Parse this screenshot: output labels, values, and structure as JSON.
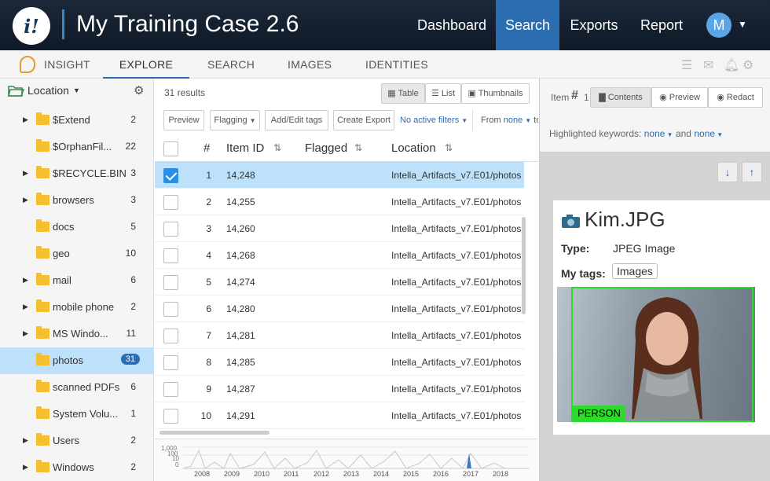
{
  "app": {
    "title": "My Training Case 2.6",
    "logo_text": "i!"
  },
  "topnav": {
    "dashboard": "Dashboard",
    "search": "Search",
    "exports": "Exports",
    "report": "Report",
    "avatar": "M"
  },
  "tabs": {
    "insight": "INSIGHT",
    "explore": "EXPLORE",
    "search": "SEARCH",
    "images": "IMAGES",
    "identities": "IDENTITIES"
  },
  "left": {
    "header": "Location",
    "items": [
      {
        "name": "$Extend",
        "count": "2",
        "arrow": true
      },
      {
        "name": "$OrphanFil...",
        "count": "22",
        "arrow": false
      },
      {
        "name": "$RECYCLE.BIN",
        "count": "3",
        "arrow": true
      },
      {
        "name": "browsers",
        "count": "3",
        "arrow": true
      },
      {
        "name": "docs",
        "count": "5",
        "arrow": false
      },
      {
        "name": "geo",
        "count": "10",
        "arrow": false
      },
      {
        "name": "mail",
        "count": "6",
        "arrow": true
      },
      {
        "name": "mobile phone",
        "count": "2",
        "arrow": true
      },
      {
        "name": "MS Windo...",
        "count": "11",
        "arrow": true
      },
      {
        "name": "photos",
        "count": "31",
        "arrow": false
      },
      {
        "name": "scanned PDFs",
        "count": "6",
        "arrow": false
      },
      {
        "name": "System Volu...",
        "count": "1",
        "arrow": false
      },
      {
        "name": "Users",
        "count": "2",
        "arrow": true
      },
      {
        "name": "Windows",
        "count": "2",
        "arrow": true
      }
    ]
  },
  "mid": {
    "results": "31 results",
    "view_table": "Table",
    "view_list": "List",
    "view_thumbnails": "Thumbnails",
    "btn_preview": "Preview",
    "btn_flagging": "Flagging",
    "btn_add_edit_tags": "Add/Edit tags",
    "btn_create_export": "Create Export",
    "filters": "No active filters",
    "from_label": "From",
    "from_value": "none",
    "to_label": "to",
    "col_num": "#",
    "col_item_id": "Item ID",
    "col_flagged": "Flagged",
    "col_location": "Location",
    "rows": [
      {
        "n": "1",
        "id": "14,248",
        "loc": "Intella_Artifacts_v7.E01/photos"
      },
      {
        "n": "2",
        "id": "14,255",
        "loc": "Intella_Artifacts_v7.E01/photos"
      },
      {
        "n": "3",
        "id": "14,260",
        "loc": "Intella_Artifacts_v7.E01/photos"
      },
      {
        "n": "4",
        "id": "14,268",
        "loc": "Intella_Artifacts_v7.E01/photos"
      },
      {
        "n": "5",
        "id": "14,274",
        "loc": "Intella_Artifacts_v7.E01/photos"
      },
      {
        "n": "6",
        "id": "14,280",
        "loc": "Intella_Artifacts_v7.E01/photos"
      },
      {
        "n": "7",
        "id": "14,281",
        "loc": "Intella_Artifacts_v7.E01/photos"
      },
      {
        "n": "8",
        "id": "14,285",
        "loc": "Intella_Artifacts_v7.E01/photos"
      },
      {
        "n": "9",
        "id": "14,287",
        "loc": "Intella_Artifacts_v7.E01/photos"
      },
      {
        "n": "10",
        "id": "14,291",
        "loc": "Intella_Artifacts_v7.E01/photos"
      }
    ],
    "timeline_y": [
      "1,000",
      "100",
      "10",
      "0"
    ],
    "timeline_years": [
      "2008",
      "2009",
      "2010",
      "2011",
      "2012",
      "2013",
      "2014",
      "2015",
      "2016",
      "2017",
      "2018"
    ]
  },
  "right": {
    "item_label": "Item",
    "item_hash": "#",
    "item_num": "1",
    "tab_contents": "Contents",
    "tab_preview": "Preview",
    "tab_redact": "Redact",
    "hl_label": "Highlighted keywords:",
    "hl_value1": "none",
    "hl_and": "and",
    "hl_value2": "none",
    "file_name": "Kim.JPG",
    "type_label": "Type:",
    "type_value": "JPEG Image",
    "tags_label": "My tags:",
    "tag": "Images",
    "detection": "PERSON"
  },
  "colors": {
    "accent": "#2c6cb0",
    "selection": "#bde0fb",
    "detection": "#2bdc2b",
    "folder": "#f4c030"
  }
}
